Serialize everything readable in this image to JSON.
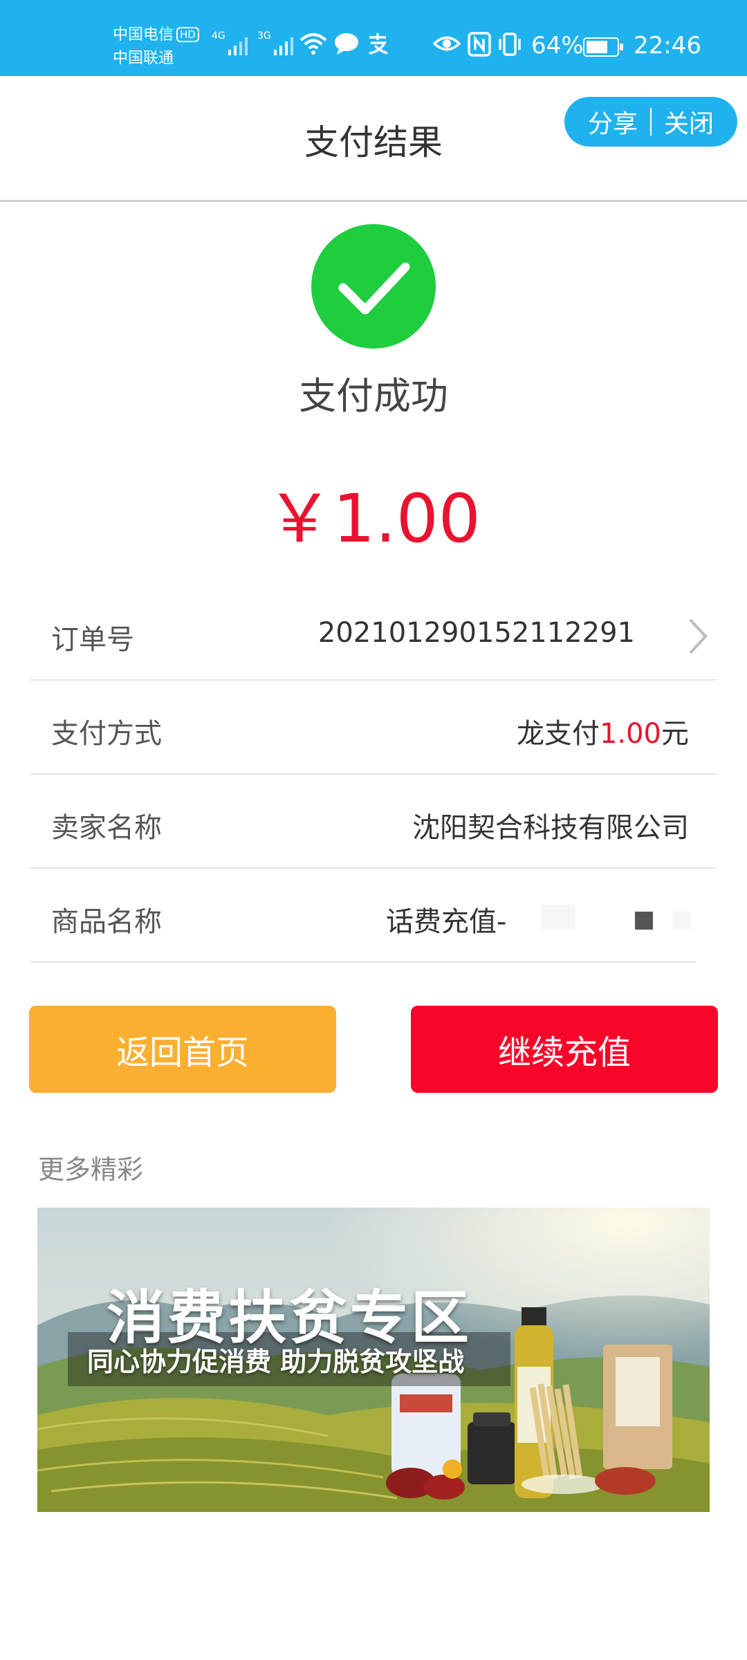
{
  "status_bar": {
    "carrier1": "中国电信",
    "hd_badge": "HD",
    "carrier2": "中国联通",
    "net1": "4G",
    "net2": "3G",
    "battery_percent": "64%",
    "time": "22:46"
  },
  "header": {
    "title": "支付结果",
    "share_label": "分享",
    "close_label": "关闭"
  },
  "result": {
    "status_text": "支付成功",
    "amount": "￥1.00",
    "success_color": "#1fcd3e",
    "amount_color": "#e8132f"
  },
  "details": {
    "order_label": "订单号",
    "order_value": "202101290152112291",
    "method_label": "支付方式",
    "method_prefix": "龙支付",
    "method_amount": "1.00",
    "method_suffix": "元",
    "seller_label": "卖家名称",
    "seller_value": "沈阳契合科技有限公司",
    "product_label": "商品名称",
    "product_value": "话费充值-"
  },
  "actions": {
    "home_label": "返回首页",
    "recharge_label": "继续充值",
    "home_color": "#fbaf31",
    "recharge_color": "#f8062a"
  },
  "more": {
    "section_title": "更多精彩",
    "banner_title": "消费扶贫专区",
    "banner_subtitle": "同心协力促消费 助力脱贫攻坚战"
  }
}
